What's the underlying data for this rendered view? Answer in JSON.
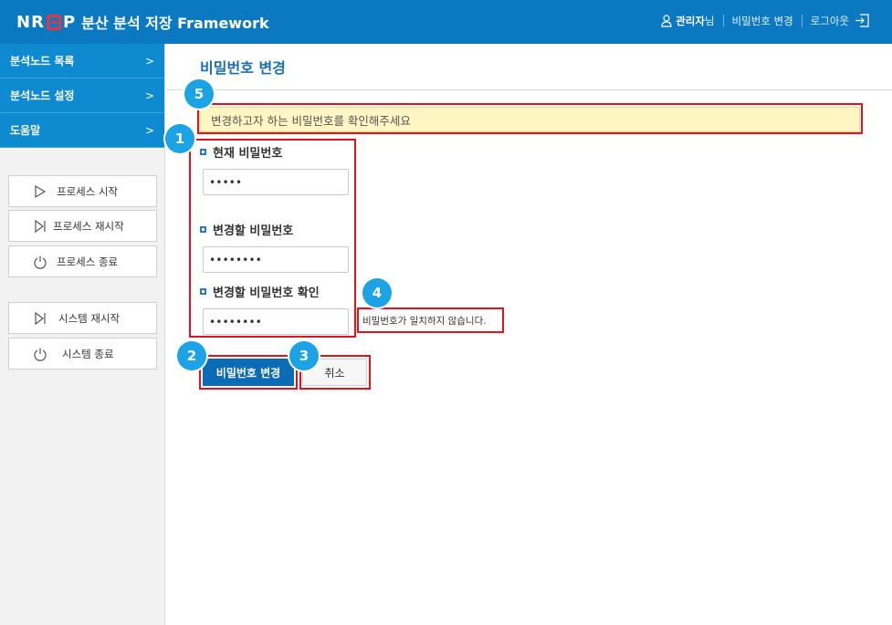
{
  "header": {
    "logo_mark": "NRBP",
    "logo_text": "분산 분석 저장 Framework",
    "admin_name": "관리자",
    "admin_suffix": "님",
    "change_password_link": "비밀번호 변경",
    "logout_link": "로그아웃"
  },
  "sidebar": {
    "nav": [
      {
        "label": "분석노드 목록",
        "chevron": ">"
      },
      {
        "label": "분석노드 설정",
        "chevron": ">"
      },
      {
        "label": "도움말",
        "chevron": ">"
      }
    ],
    "process_buttons": [
      {
        "label": "프로세스 시작",
        "icon": "play-icon"
      },
      {
        "label": "프로세스 재시작",
        "icon": "restart-icon"
      },
      {
        "label": "프로세스 종료",
        "icon": "power-icon"
      }
    ],
    "system_buttons": [
      {
        "label": "시스템 재시작",
        "icon": "restart-icon"
      },
      {
        "label": "시스템 종료",
        "icon": "power-icon"
      }
    ]
  },
  "main": {
    "title": "비밀번호 변경",
    "notice": "변경하고자 하는 비밀번호를 확인해주세요",
    "fields": [
      {
        "label": "현재 비밀번호",
        "value": "•••••"
      },
      {
        "label": "변경할 비밀번호",
        "value": "••••••••"
      },
      {
        "label": "변경할 비밀번호 확인",
        "value": "••••••••"
      }
    ],
    "error_message": "비밀번호가 일치하지 않습니다.",
    "submit_label": "비밀번호 변경",
    "cancel_label": "취소"
  },
  "annotations": [
    "1",
    "2",
    "3",
    "4",
    "5"
  ],
  "colors": {
    "header_bg": "#0b78c2",
    "nav_bg": "#0e8bd0",
    "accent": "#1a6fb0",
    "highlight": "#e1141e",
    "badge": "#1ca3e6",
    "notice_bg": "#fff6c4"
  }
}
